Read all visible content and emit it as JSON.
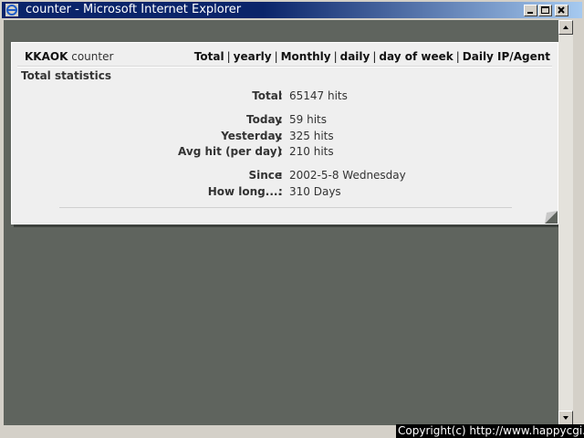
{
  "window": {
    "title": "counter - Microsoft Internet Explorer"
  },
  "header": {
    "brand_bold": "KKAOK",
    "brand_rest": "counter",
    "nav": [
      "Total",
      "yearly",
      "Monthly",
      "daily",
      "day of week",
      "Daily IP/Agent"
    ]
  },
  "section_title": "Total statistics",
  "stats": {
    "total": {
      "label": "Total",
      "value": "65147 hits"
    },
    "today": {
      "label": "Today",
      "value": "59 hits"
    },
    "yesterday": {
      "label": "Yesterday",
      "value": "325 hits"
    },
    "avg": {
      "label": "Avg hit (per day)",
      "value": "210 hits"
    },
    "since": {
      "label": "Since",
      "value": "2002-5-8 Wednesday"
    },
    "howlong": {
      "label": "How long....",
      "value": "310 Days"
    }
  },
  "copyright": "Copyright(c) http://www.happycgi.com"
}
